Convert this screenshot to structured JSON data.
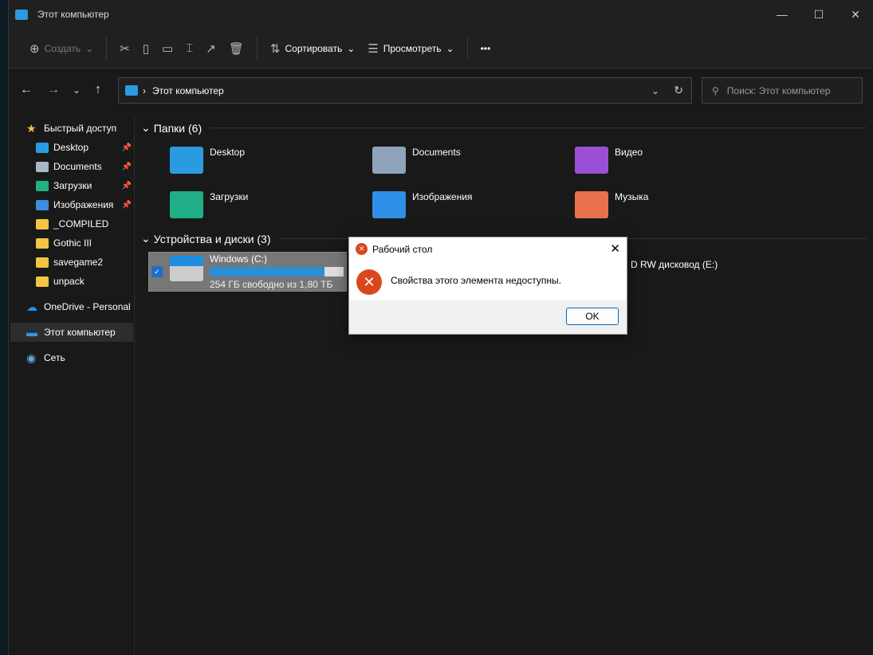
{
  "window": {
    "title": "Этот компьютер",
    "minimize": "—",
    "maximize": "☐",
    "close": "✕"
  },
  "toolbar": {
    "create": "Создать",
    "sort": "Сортировать",
    "view": "Просмотреть",
    "more": "•••"
  },
  "address": {
    "path": "Этот компьютер",
    "search_placeholder": "Поиск: Этот компьютер"
  },
  "sidebar": {
    "items": [
      {
        "label": "Быстрый доступ",
        "icon": "star-icon"
      },
      {
        "label": "Desktop",
        "pinned": true,
        "color": "#2a9be0"
      },
      {
        "label": "Documents",
        "pinned": true,
        "color": "#a9b8c8"
      },
      {
        "label": "Загрузки",
        "pinned": true,
        "color": "#22b37e"
      },
      {
        "label": "Изображения",
        "pinned": true,
        "color": "#3a8fe0"
      },
      {
        "label": "_COMPILED",
        "color": "#f4c542"
      },
      {
        "label": "Gothic III",
        "color": "#f4c542"
      },
      {
        "label": "savegame2",
        "color": "#f4c542"
      },
      {
        "label": "unpack",
        "color": "#f4c542"
      },
      {
        "label": "OneDrive - Personal",
        "icon": "cloud-icon"
      },
      {
        "label": "Этот компьютер",
        "icon": "computer-icon",
        "selected": true
      },
      {
        "label": "Сеть",
        "icon": "network-icon"
      }
    ]
  },
  "folders": {
    "header": "Папки (6)",
    "items": [
      {
        "label": "Desktop",
        "color": "#2a9be0"
      },
      {
        "label": "Documents",
        "color": "#8fa4ba"
      },
      {
        "label": "Видео",
        "color": "#9b4fd6"
      },
      {
        "label": "Загрузки",
        "color": "#1fae86"
      },
      {
        "label": "Изображения",
        "color": "#2f8fe6"
      },
      {
        "label": "Музыка",
        "color": "#e8704a"
      }
    ]
  },
  "devices": {
    "header": "Устройства и диски (3)",
    "items": [
      {
        "label": "Windows (C:)",
        "info": "254 ГБ свободно из 1,80 ТБ",
        "used_percent": 86
      },
      {
        "label": "D RW дисковод (E:)"
      }
    ]
  },
  "dialog": {
    "title": "Рабочий стол",
    "message": "Свойства этого элемента недоступны.",
    "ok": "OK",
    "close": "✕"
  }
}
